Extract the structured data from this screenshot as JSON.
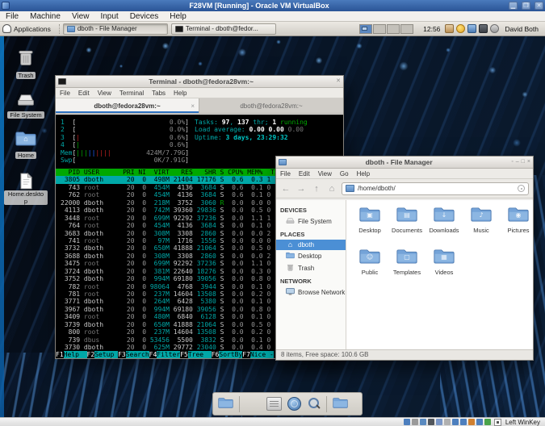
{
  "colors": {
    "accent_blue": "#2f73c2",
    "selection_blue": "#4b8fd5",
    "htop_header_green": "#00a800",
    "htop_cursor_cyan": "#00a8a8",
    "titlebar_blue": "#2a5496"
  },
  "vbox": {
    "title": "F28VM [Running] - Oracle VM VirtualBox",
    "menu": [
      "File",
      "Machine",
      "View",
      "Input",
      "Devices",
      "Help"
    ],
    "window_buttons": [
      "minimize",
      "maximize",
      "close"
    ],
    "status_icons": [
      {
        "name": "hdd-status-icon",
        "color": "#4d7fbe"
      },
      {
        "name": "cd-status-icon",
        "color": "#9a9a9a"
      },
      {
        "name": "audio-status-icon",
        "color": "#5a8ac0"
      },
      {
        "name": "network-status-icon",
        "color": "#52565c"
      },
      {
        "name": "usb-status-icon",
        "color": "#7a97c8"
      },
      {
        "name": "shared-folders-status-icon",
        "color": "#b0b0b0"
      },
      {
        "name": "display-status-icon",
        "color": "#4d7fbe"
      },
      {
        "name": "recording-status-icon",
        "color": "#4d7fbe"
      },
      {
        "name": "features-status-icon",
        "color": "#d08030"
      },
      {
        "name": "mouse-status-icon",
        "color": "#4d7fbe"
      },
      {
        "name": "keyboard-status-icon",
        "color": "#4aa34a"
      }
    ],
    "host_key_hint": "Left WinKey"
  },
  "taskbar": {
    "applications_label": "Applications",
    "tasks": [
      {
        "label": "dboth - File Manager",
        "icon": "folder",
        "active": true
      },
      {
        "label": "Terminal - dboth@fedor...",
        "icon": "terminal",
        "active": false
      }
    ],
    "workspaces": 4,
    "current_workspace": 0,
    "clock": "12:56",
    "tray_icons": [
      "clipboard",
      "updates",
      "network",
      "volume",
      "session"
    ],
    "user": "David Both"
  },
  "desktop": {
    "icons": [
      {
        "label": "Trash",
        "type": "trash"
      },
      {
        "label": "File System",
        "type": "drive"
      },
      {
        "label": "Home",
        "type": "folder"
      },
      {
        "label": "Home.desktop",
        "type": "file"
      }
    ]
  },
  "terminal": {
    "title": "Terminal - dboth@fedora28vm:~",
    "menu": [
      "File",
      "Edit",
      "View",
      "Terminal",
      "Tabs",
      "Help"
    ],
    "tabs": [
      {
        "label": "dboth@fedora28vm:~",
        "active": true
      },
      {
        "label": "dboth@fedora28vm:~",
        "active": false
      }
    ],
    "htop": {
      "meters": [
        {
          "label": "1",
          "ticks": "",
          "value": "0.0%"
        },
        {
          "label": "2",
          "ticks": "",
          "value": "0.0%"
        },
        {
          "label": "3",
          "ticks": "r",
          "value": "0.6%"
        },
        {
          "label": "4",
          "ticks": "g",
          "value": "0.6%"
        },
        {
          "label": "Mem",
          "ticks": "gggbbrrrr",
          "value": "424M/7.79G"
        },
        {
          "label": "Swp",
          "ticks": "",
          "value": "0K/7.91G"
        }
      ],
      "info_lines": [
        [
          [
            "Tasks: ",
            "lbl"
          ],
          [
            "97",
            "num"
          ],
          [
            ", ",
            "lbl"
          ],
          [
            "137",
            "num"
          ],
          [
            " thr; ",
            "lbl"
          ],
          [
            "1",
            "num"
          ],
          [
            " running",
            "run"
          ]
        ],
        [
          [
            "Load average: ",
            "lbl"
          ],
          [
            "0.00 ",
            "num"
          ],
          [
            "0.00 ",
            "num"
          ],
          [
            "0.00",
            "dim"
          ]
        ],
        [
          [
            "Uptime: ",
            "lbl"
          ],
          [
            "3 days, 23:29:32",
            "upt"
          ]
        ]
      ],
      "columns": [
        "PID",
        "USER",
        "PRI",
        "NI",
        "VIRT",
        "RES",
        "SHR",
        "S",
        "CPU%",
        "MEM%",
        "TIME+"
      ],
      "selected_index": 0,
      "rows": [
        [
          "3805",
          "dboth",
          "20",
          "0",
          "498M",
          "21404",
          "17176",
          "S",
          "0.6",
          "0.3",
          "1"
        ],
        [
          "743",
          "root",
          "20",
          "0",
          "454M",
          "4136",
          "3684",
          "S",
          "0.6",
          "0.1",
          "0"
        ],
        [
          "762",
          "root",
          "20",
          "0",
          "454M",
          "4136",
          "3684",
          "S",
          "0.6",
          "0.1",
          "0"
        ],
        [
          "22000",
          "dboth",
          "20",
          "0",
          "218M",
          "3752",
          "3060",
          "R",
          "0.0",
          "0.0",
          "0"
        ],
        [
          "4113",
          "dboth",
          "20",
          "0",
          "742M",
          "39360",
          "29836",
          "S",
          "0.0",
          "0.5",
          "0"
        ],
        [
          "3448",
          "root",
          "20",
          "0",
          "699M",
          "92292",
          "37236",
          "S",
          "0.0",
          "1.1",
          "1"
        ],
        [
          "764",
          "root",
          "20",
          "0",
          "454M",
          "4136",
          "3684",
          "S",
          "0.0",
          "0.1",
          "0"
        ],
        [
          "3683",
          "dboth",
          "20",
          "0",
          "308M",
          "3308",
          "2860",
          "S",
          "0.0",
          "0.0",
          "2"
        ],
        [
          "741",
          "root",
          "20",
          "0",
          "97M",
          "1716",
          "1556",
          "S",
          "0.0",
          "0.0",
          "0"
        ],
        [
          "3732",
          "dboth",
          "20",
          "0",
          "650M",
          "41888",
          "21064",
          "S",
          "0.0",
          "0.5",
          "0"
        ],
        [
          "3688",
          "dboth",
          "20",
          "0",
          "308M",
          "3308",
          "2860",
          "S",
          "0.0",
          "0.0",
          "2"
        ],
        [
          "3475",
          "root",
          "20",
          "0",
          "699M",
          "92292",
          "37236",
          "S",
          "0.0",
          "1.1",
          "0"
        ],
        [
          "3724",
          "dboth",
          "20",
          "0",
          "381M",
          "22640",
          "18276",
          "S",
          "0.0",
          "0.3",
          "0"
        ],
        [
          "3752",
          "dboth",
          "20",
          "0",
          "994M",
          "69180",
          "39056",
          "S",
          "0.0",
          "0.8",
          "0"
        ],
        [
          "782",
          "root",
          "20",
          "0",
          "98064",
          "4768",
          "3944",
          "S",
          "0.0",
          "0.1",
          "0"
        ],
        [
          "781",
          "root",
          "20",
          "0",
          "237M",
          "14604",
          "13508",
          "S",
          "0.0",
          "0.2",
          "0"
        ],
        [
          "3771",
          "dboth",
          "20",
          "0",
          "264M",
          "6428",
          "5380",
          "S",
          "0.0",
          "0.1",
          "0"
        ],
        [
          "3967",
          "dboth",
          "20",
          "0",
          "994M",
          "69180",
          "39056",
          "S",
          "0.0",
          "0.8",
          "0"
        ],
        [
          "3409",
          "root",
          "20",
          "0",
          "480M",
          "6840",
          "6128",
          "S",
          "0.0",
          "0.1",
          "0"
        ],
        [
          "3739",
          "dboth",
          "20",
          "0",
          "650M",
          "41888",
          "21064",
          "S",
          "0.0",
          "0.5",
          "0"
        ],
        [
          "800",
          "root",
          "20",
          "0",
          "237M",
          "14604",
          "13508",
          "S",
          "0.0",
          "0.2",
          "0"
        ],
        [
          "739",
          "dbus",
          "20",
          "0",
          "53456",
          "5500",
          "3832",
          "S",
          "0.0",
          "0.1",
          "0"
        ],
        [
          "3730",
          "dboth",
          "20",
          "0",
          "625M",
          "29772",
          "23040",
          "S",
          "0.0",
          "0.4",
          "0"
        ]
      ],
      "fkeys": [
        {
          "key": "F1",
          "label": "Help"
        },
        {
          "key": "F2",
          "label": "Setup"
        },
        {
          "key": "F3",
          "label": "Search"
        },
        {
          "key": "F4",
          "label": "Filter"
        },
        {
          "key": "F5",
          "label": "Tree"
        },
        {
          "key": "F6",
          "label": "SortBy"
        },
        {
          "key": "F7",
          "label": "Nice -"
        }
      ]
    }
  },
  "file_manager": {
    "title": "dboth - File Manager",
    "menu": [
      "File",
      "Edit",
      "View",
      "Go",
      "Help"
    ],
    "window_buttons": [
      "sticky",
      "minimize",
      "maximize",
      "close"
    ],
    "path": "/home/dboth/",
    "nav": [
      "back",
      "forward",
      "up",
      "home"
    ],
    "sidebar": [
      {
        "title": "DEVICES",
        "items": [
          {
            "label": "File System",
            "icon": "drive",
            "selected": false
          }
        ]
      },
      {
        "title": "PLACES",
        "items": [
          {
            "label": "dboth",
            "icon": "home",
            "selected": true
          },
          {
            "label": "Desktop",
            "icon": "folder",
            "selected": false
          },
          {
            "label": "Trash",
            "icon": "trash",
            "selected": false
          }
        ]
      },
      {
        "title": "NETWORK",
        "items": [
          {
            "label": "Browse Network",
            "icon": "network",
            "selected": false
          }
        ]
      }
    ],
    "folders": [
      {
        "name": "Desktop",
        "emblem": "▣"
      },
      {
        "name": "Documents",
        "emblem": "▤"
      },
      {
        "name": "Downloads",
        "emblem": "↓"
      },
      {
        "name": "Music",
        "emblem": "♪"
      },
      {
        "name": "Pictures",
        "emblem": "◉"
      },
      {
        "name": "Public",
        "emblem": "☺"
      },
      {
        "name": "Templates",
        "emblem": "▢"
      },
      {
        "name": "Videos",
        "emblem": "▦"
      }
    ],
    "status": "8 items, Free space: 100.6 GB"
  },
  "dock": {
    "items": [
      "file-manager",
      "terminal",
      "editor",
      "browser",
      "search",
      "folder"
    ]
  }
}
